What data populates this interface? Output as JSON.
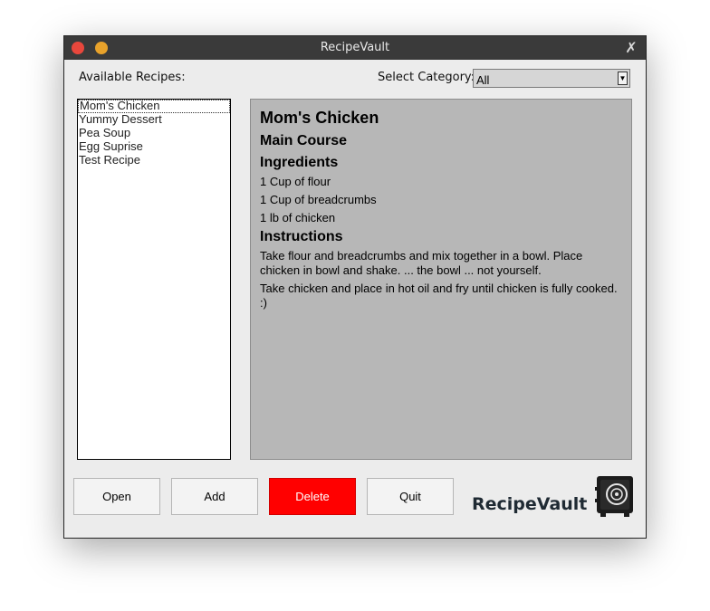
{
  "window": {
    "title": "RecipeVault"
  },
  "labels": {
    "available": "Available Recipes:",
    "category": "Select Category:"
  },
  "category_select": {
    "value": "All"
  },
  "recipes": [
    "Mom's Chicken",
    "Yummy Dessert",
    "Pea Soup",
    "Egg Suprise",
    "Test Recipe"
  ],
  "detail": {
    "name": "Mom's Chicken",
    "category": "Main Course",
    "ingredients_heading": "Ingredients",
    "ingredients": [
      "1 Cup of flour",
      "1 Cup of breadcrumbs",
      "1 lb of chicken"
    ],
    "instructions_heading": "Instructions",
    "instructions": [
      "Take flour and breadcrumbs and mix together in a bowl. Place chicken in bowl and shake. ... the bowl ... not yourself.",
      "Take chicken and place in hot oil and fry until chicken is fully cooked. :)"
    ]
  },
  "buttons": {
    "open": "Open",
    "add": "Add",
    "delete": "Delete",
    "quit": "Quit"
  },
  "brand": {
    "name": "RecipeVault",
    "logo_icon": "safe-icon"
  },
  "colors": {
    "delete": "#ff0000",
    "detail_bg": "#b7b7b7",
    "titlebar": "#3a3a3a"
  }
}
